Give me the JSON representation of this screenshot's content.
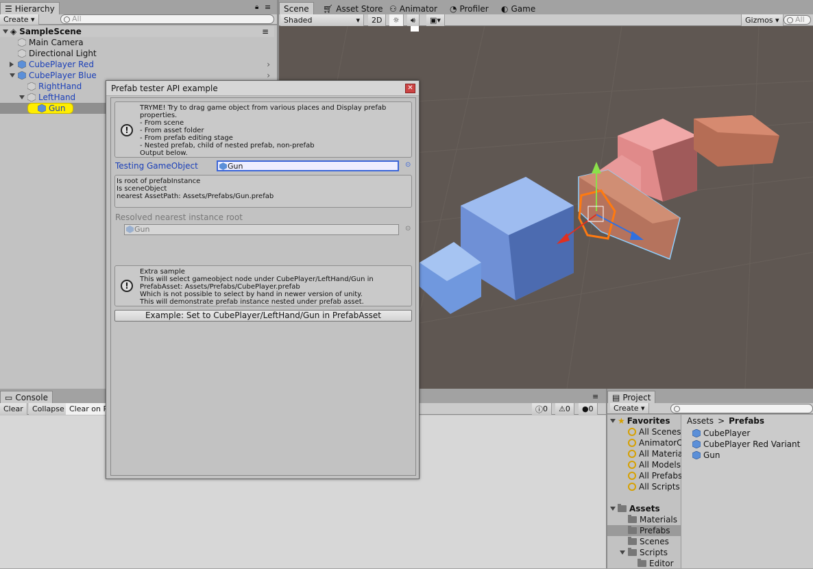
{
  "hierarchy": {
    "tab": "Hierarchy",
    "create": "Create ▾",
    "search_placeholder": "All",
    "scene": "SampleScene",
    "items": [
      {
        "label": "Main Camera",
        "blue": false
      },
      {
        "label": "Directional Light",
        "blue": false
      },
      {
        "label": "CubePlayer Red",
        "blue": true
      },
      {
        "label": "CubePlayer Blue",
        "blue": true
      },
      {
        "label": "RightHand",
        "blue": true
      },
      {
        "label": "LeftHand",
        "blue": true
      },
      {
        "label": "Gun",
        "blue": true,
        "selected": true
      }
    ]
  },
  "tabs": {
    "scene": "Scene",
    "asset_store": "Asset Store",
    "animator": "Animator",
    "profiler": "Profiler",
    "game": "Game"
  },
  "scene_toolbar": {
    "shading": "Shaded",
    "mode_2d": "2D",
    "gizmos": "Gizmos",
    "search_placeholder": "All"
  },
  "dialog": {
    "title": "Prefab tester API example",
    "help1": [
      "TRYME! Try to drag game object from various places and Display prefab",
      "properties.",
      "- From scene",
      "- From asset folder",
      "- From prefab editing stage",
      "- Nested prefab, child of nested prefab, non-prefab",
      "Output below."
    ],
    "testing_label": "Testing GameObject",
    "testing_value": "Gun",
    "output": [
      "Is root of prefabInstance",
      "Is sceneObject",
      "nearest AssetPath: Assets/Prefabs/Gun.prefab"
    ],
    "resolved_label": "Resolved nearest instance root",
    "resolved_value": "Gun",
    "help2": [
      "Extra sample",
      "This will select gameobject node under CubePlayer/LeftHand/Gun in",
      "PrefabAsset: Assets/Prefabs/CubePlayer.prefab",
      "Which is not possible to select by hand in newer version of unity.",
      "This will demonstrate prefab instance nested under prefab asset."
    ],
    "button": "Example: Set to CubePlayer/LeftHand/Gun in PrefabAsset"
  },
  "console": {
    "tab": "Console",
    "clear": "Clear",
    "collapse": "Collapse",
    "clear_on_play": "Clear on P",
    "counts": [
      "0",
      "0",
      "0"
    ]
  },
  "project": {
    "tab": "Project",
    "create": "Create ▾",
    "favorites_label": "Favorites",
    "favorites": [
      "All Scenes",
      "AnimatorC",
      "All Materia",
      "All Models",
      "All Prefabs",
      "All Scripts"
    ],
    "assets_label": "Assets",
    "folders": [
      "Materials",
      "Prefabs",
      "Scenes",
      "Scripts",
      "Editor"
    ],
    "breadcrumb": [
      "Assets",
      "Prefabs"
    ],
    "files": [
      "CubePlayer",
      "CubePlayer Red Variant",
      "Gun"
    ]
  }
}
